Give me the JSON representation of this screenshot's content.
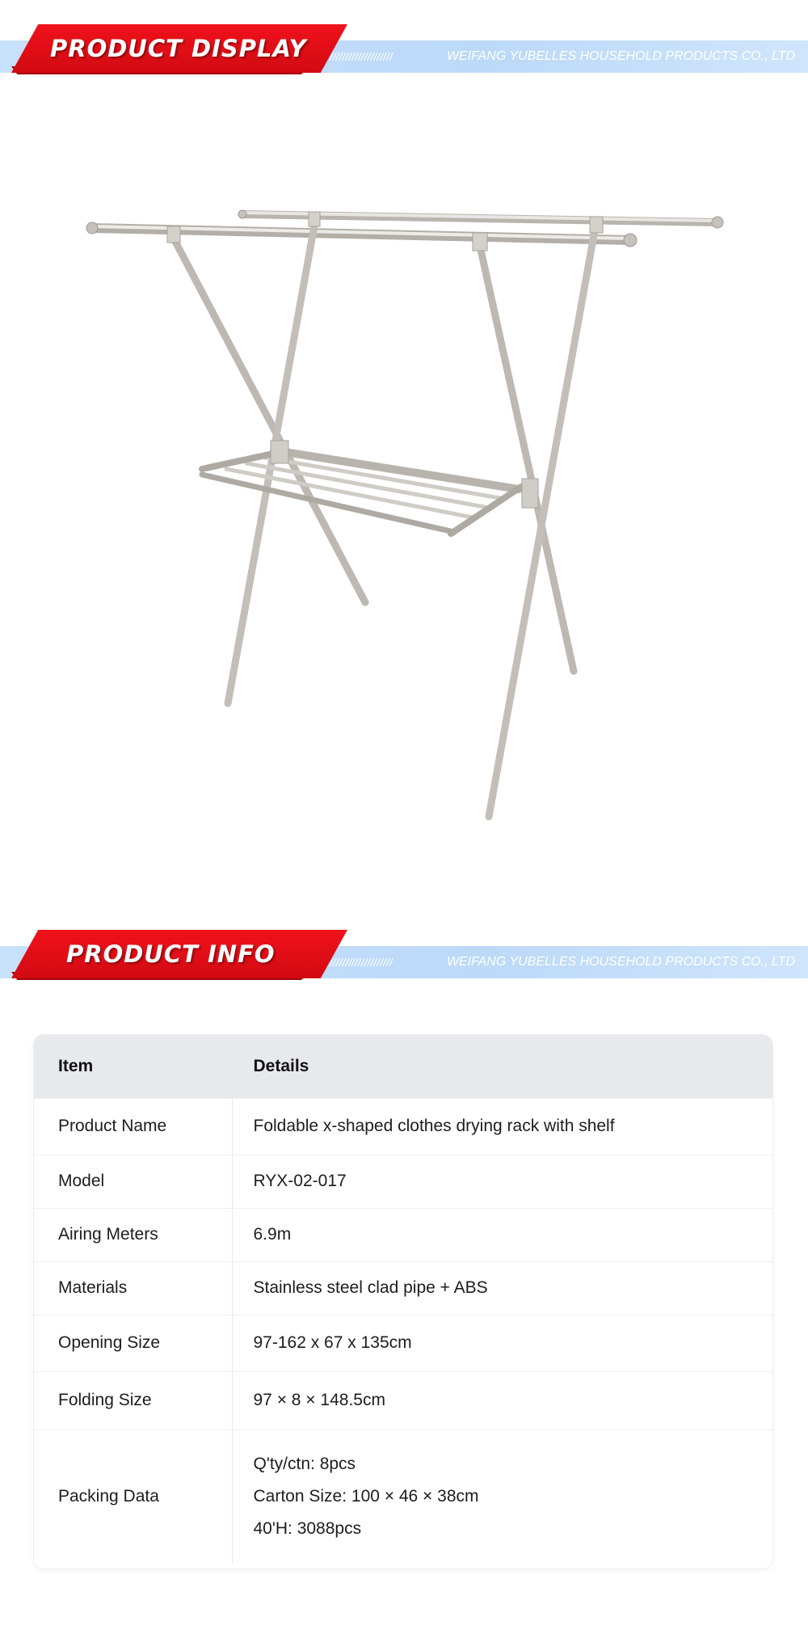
{
  "banners": {
    "display": {
      "title": "PRODUCT DISPLAY",
      "slashes": "////////////////////",
      "company": "WEIFANG YUBELLES HOUSEHOLD PRODUCTS CO., LTD"
    },
    "info": {
      "title": "PRODUCT INFO",
      "slashes": "////////////////////",
      "company": "WEIFANG YUBELLES HOUSEHOLD PRODUCTS CO., LTD"
    }
  },
  "colors": {
    "accent_red": "#e10f18",
    "banner_blue": "#c5dffa",
    "table_header": "#e8e9eb"
  },
  "table": {
    "headers": [
      "Item",
      "Details"
    ],
    "rows": [
      {
        "item": "Product Name",
        "details": "Foldable x-shaped clothes drying rack with shelf"
      },
      {
        "item": "Model",
        "details": "RYX-02-017"
      },
      {
        "item": "Airing Meters",
        "details": "6.9m"
      },
      {
        "item": "Materials",
        "details": "Stainless steel clad pipe + ABS"
      },
      {
        "item": "Opening Size",
        "details": "97-162 x 67 x 135cm"
      },
      {
        "item": "Folding Size",
        "details": "97 × 8 × 148.5cm"
      },
      {
        "item": "Packing Data",
        "details_lines": [
          "Q'ty/ctn: 8pcs",
          "Carton Size: 100 × 46 × 38cm",
          "40'H: 3088pcs"
        ]
      }
    ]
  }
}
